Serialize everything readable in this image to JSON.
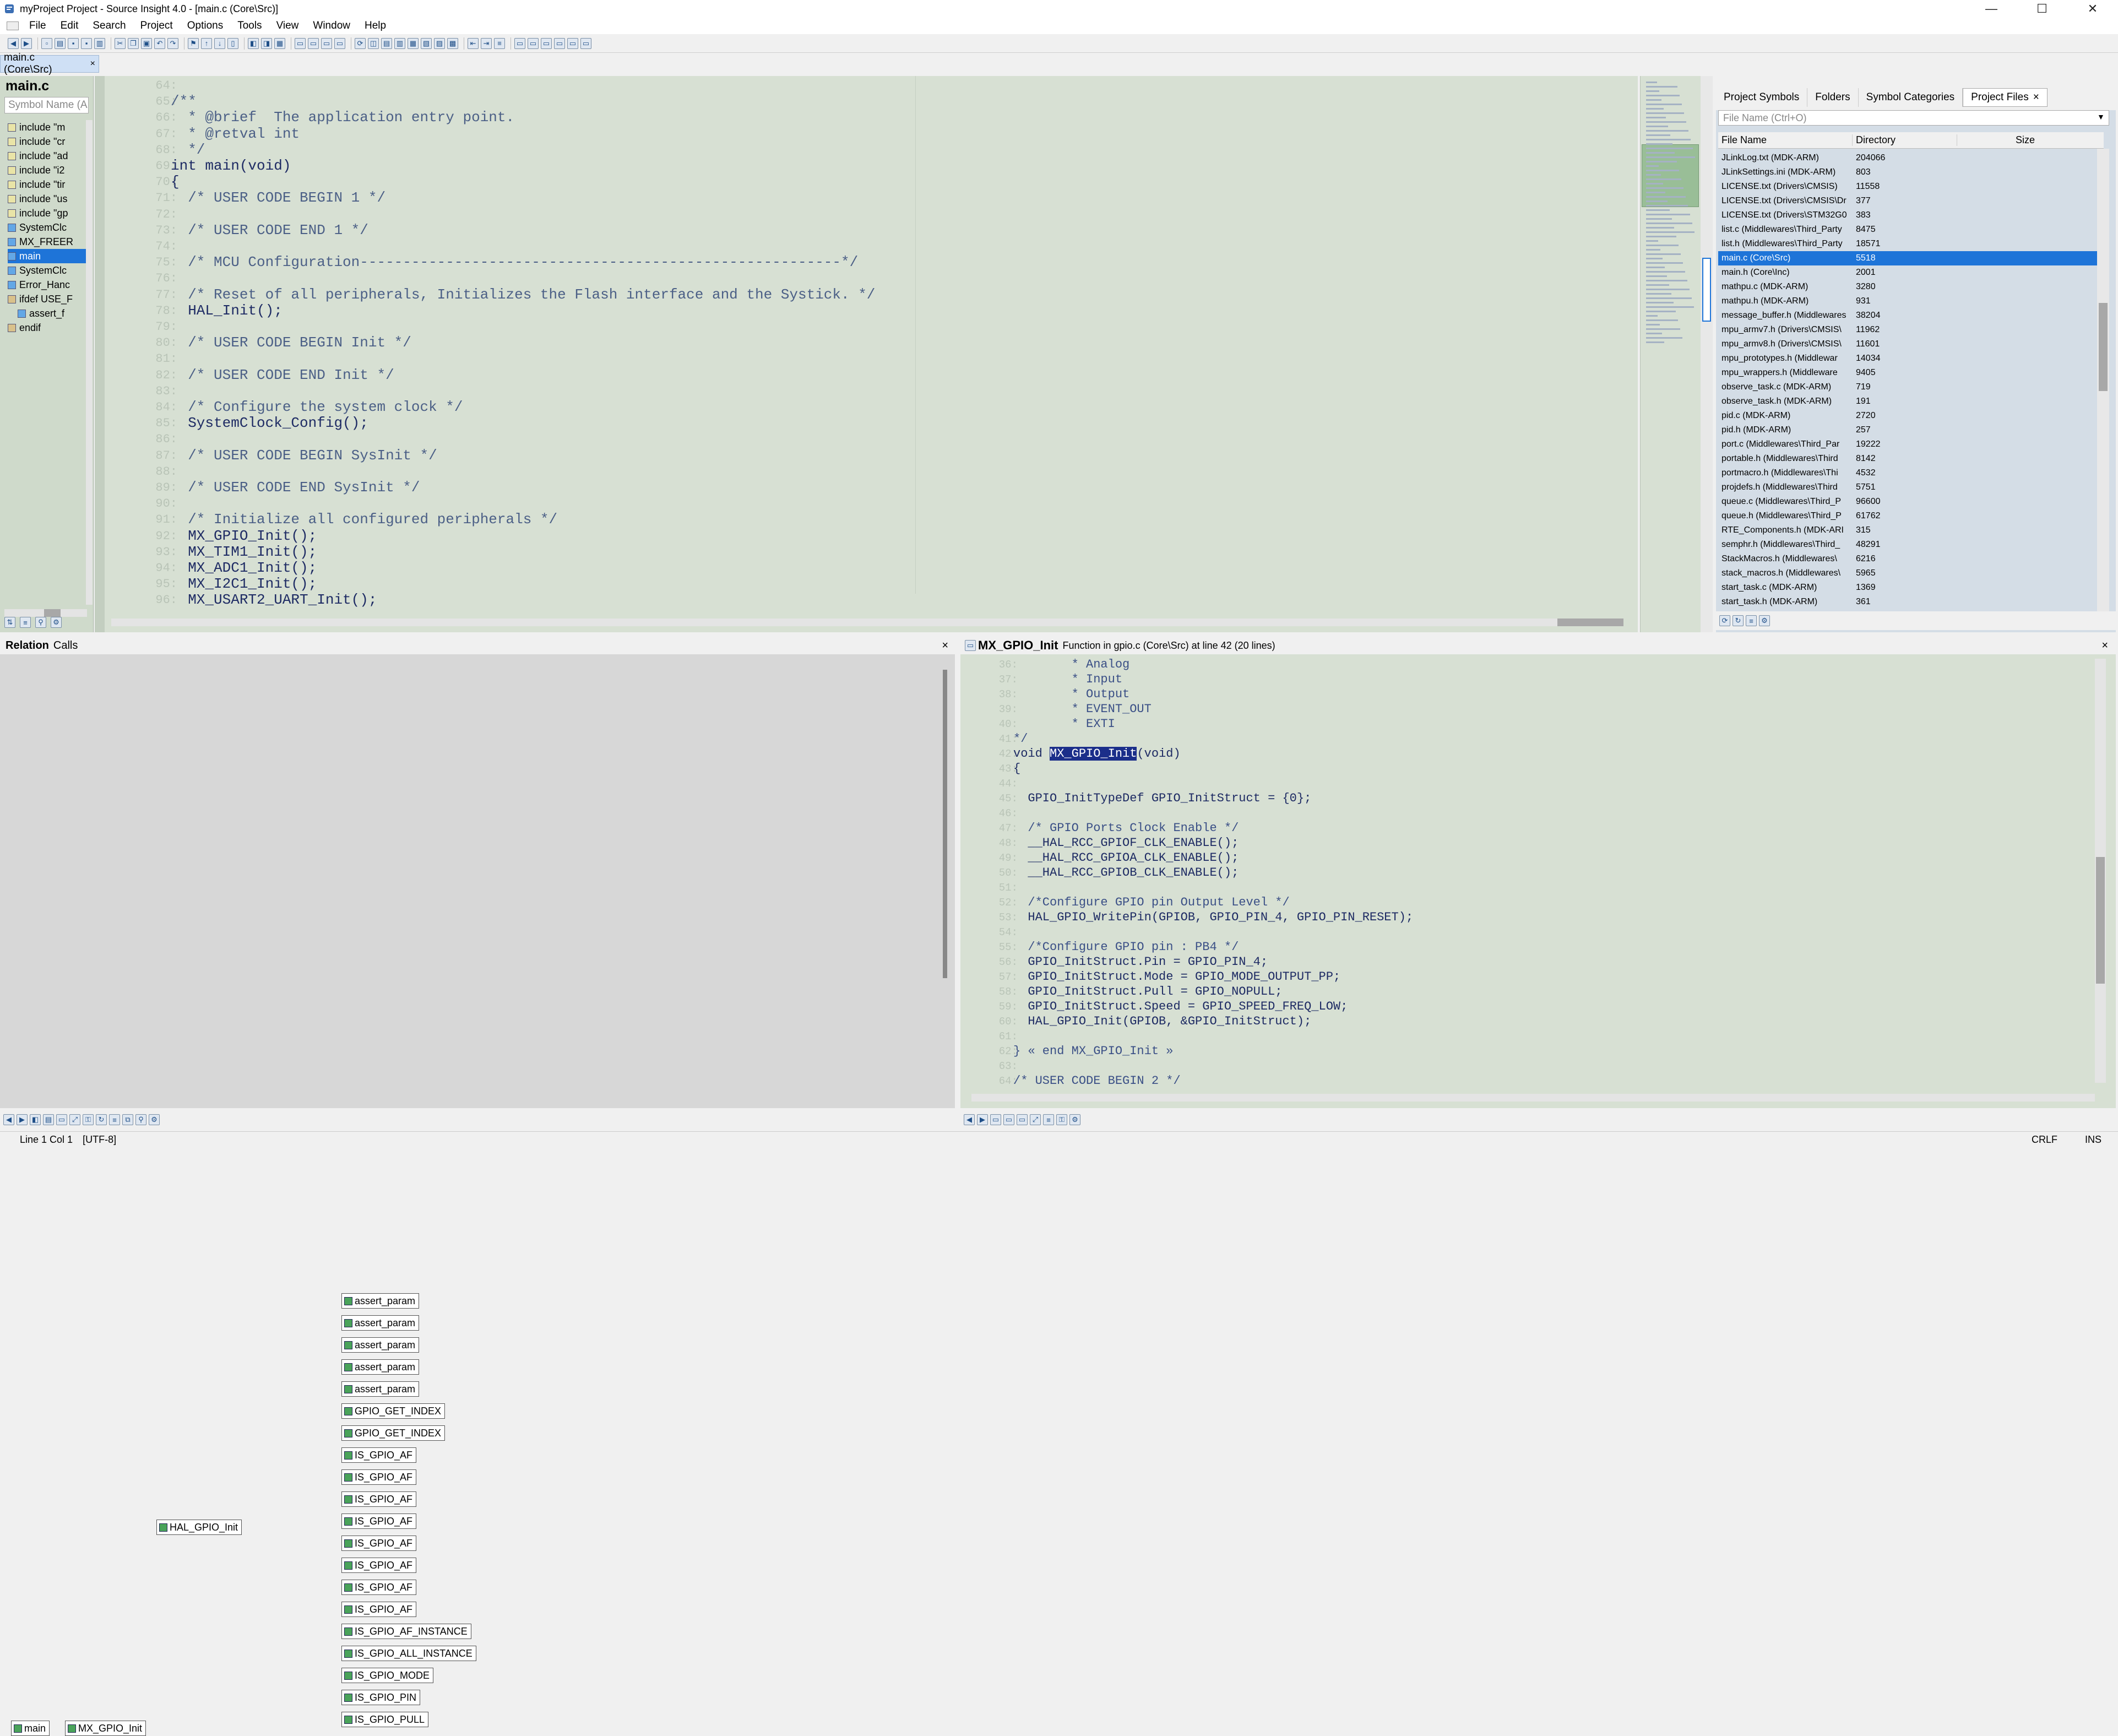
{
  "window": {
    "title": "myProject Project - Source Insight 4.0 - [main.c (Core\\Src)]",
    "minimize": "—",
    "maximize": "☐",
    "close": "✕"
  },
  "menu": [
    "File",
    "Edit",
    "Search",
    "Project",
    "Options",
    "Tools",
    "View",
    "Window",
    "Help"
  ],
  "doc_tab": {
    "label": "main.c (Core\\Src)",
    "close": "×"
  },
  "symbol_window": {
    "title": "main.c",
    "search_placeholder": "Symbol Name (A",
    "items": [
      {
        "label": "include \"m",
        "kind": "include"
      },
      {
        "label": "include \"cr",
        "kind": "include"
      },
      {
        "label": "include \"ad",
        "kind": "include"
      },
      {
        "label": "include \"i2",
        "kind": "include"
      },
      {
        "label": "include \"tir",
        "kind": "include"
      },
      {
        "label": "include \"us",
        "kind": "include"
      },
      {
        "label": "include \"gp",
        "kind": "include"
      },
      {
        "label": "SystemClc",
        "kind": "function"
      },
      {
        "label": "MX_FREER",
        "kind": "function"
      },
      {
        "label": "main",
        "kind": "function",
        "selected": true
      },
      {
        "label": "SystemClc",
        "kind": "function"
      },
      {
        "label": "Error_Hanc",
        "kind": "function"
      },
      {
        "label": "ifdef USE_F",
        "kind": "ifdef"
      },
      {
        "label": "assert_f",
        "kind": "function"
      },
      {
        "label": "endif",
        "kind": "ifdef"
      }
    ]
  },
  "code": {
    "line_numbers": [
      "64:",
      "65:",
      "66:",
      "67:",
      "68:",
      "69:",
      "70:",
      "71:",
      "72:",
      "73:",
      "74:",
      "75:",
      "76:",
      "77:",
      "78:",
      "79:",
      "80:",
      "81:",
      "82:",
      "83:",
      "84:",
      "85:",
      "86:",
      "87:",
      "88:",
      "89:",
      "90:",
      "91:",
      "92:",
      "93:",
      "94:",
      "95:",
      "96:"
    ],
    "lines": [
      "",
      "/**",
      "  * @brief  The application entry point.",
      "  * @retval int",
      "  */",
      "int main(void)",
      "{",
      "  /* USER CODE BEGIN 1 */",
      "",
      "  /* USER CODE END 1 */",
      "",
      "  /* MCU Configuration--------------------------------------------------------*/",
      "",
      "  /* Reset of all peripherals, Initializes the Flash interface and the Systick. */",
      "  HAL_Init();",
      "",
      "  /* USER CODE BEGIN Init */",
      "",
      "  /* USER CODE END Init */",
      "",
      "  /* Configure the system clock */",
      "  SystemClock_Config();",
      "",
      "  /* USER CODE BEGIN SysInit */",
      "",
      "  /* USER CODE END SysInit */",
      "",
      "  /* Initialize all configured peripherals */",
      "  MX_GPIO_Init();",
      "  MX_TIM1_Init();",
      "  MX_ADC1_Init();",
      "  MX_I2C1_Init();",
      "  MX_USART2_UART_Init();"
    ]
  },
  "project": {
    "tabs": [
      "Project Symbols",
      "Folders",
      "Symbol Categories",
      "Project Files"
    ],
    "active_tab_close": "×",
    "search_placeholder": "File Name (Ctrl+O)",
    "columns": [
      "File Name",
      "Directory",
      "Size"
    ],
    "files": [
      {
        "name": "JLinkLog.txt (MDK-ARM)",
        "size": "204066"
      },
      {
        "name": "JLinkSettings.ini (MDK-ARM)",
        "size": "803"
      },
      {
        "name": "LICENSE.txt (Drivers\\CMSIS)",
        "size": "11558"
      },
      {
        "name": "LICENSE.txt (Drivers\\CMSIS\\Dr",
        "size": "377"
      },
      {
        "name": "LICENSE.txt (Drivers\\STM32G0",
        "size": "383"
      },
      {
        "name": "list.c (Middlewares\\Third_Party",
        "size": "8475"
      },
      {
        "name": "list.h (Middlewares\\Third_Party",
        "size": "18571"
      },
      {
        "name": "main.c (Core\\Src)",
        "size": "5518",
        "selected": true
      },
      {
        "name": "main.h (Core\\Inc)",
        "size": "2001"
      },
      {
        "name": "mathpu.c (MDK-ARM)",
        "size": "3280"
      },
      {
        "name": "mathpu.h (MDK-ARM)",
        "size": "931"
      },
      {
        "name": "message_buffer.h (Middlewares",
        "size": "38204"
      },
      {
        "name": "mpu_armv7.h (Drivers\\CMSIS\\",
        "size": "11962"
      },
      {
        "name": "mpu_armv8.h (Drivers\\CMSIS\\",
        "size": "11601"
      },
      {
        "name": "mpu_prototypes.h (Middlewar",
        "size": "14034"
      },
      {
        "name": "mpu_wrappers.h (Middleware",
        "size": "9405"
      },
      {
        "name": "observe_task.c (MDK-ARM)",
        "size": "719"
      },
      {
        "name": "observe_task.h (MDK-ARM)",
        "size": "191"
      },
      {
        "name": "pid.c (MDK-ARM)",
        "size": "2720"
      },
      {
        "name": "pid.h (MDK-ARM)",
        "size": "257"
      },
      {
        "name": "port.c (Middlewares\\Third_Par",
        "size": "19222"
      },
      {
        "name": "portable.h (Middlewares\\Third",
        "size": "8142"
      },
      {
        "name": "portmacro.h (Middlewares\\Thi",
        "size": "4532"
      },
      {
        "name": "projdefs.h (Middlewares\\Third",
        "size": "5751"
      },
      {
        "name": "queue.c (Middlewares\\Third_P",
        "size": "96600"
      },
      {
        "name": "queue.h (Middlewares\\Third_P",
        "size": "61762"
      },
      {
        "name": "RTE_Components.h (MDK-ARI",
        "size": "315"
      },
      {
        "name": "semphr.h (Middlewares\\Third_",
        "size": "48291"
      },
      {
        "name": "StackMacros.h (Middlewares\\",
        "size": "6216"
      },
      {
        "name": "stack_macros.h (Middlewares\\",
        "size": "5965"
      },
      {
        "name": "start_task.c (MDK-ARM)",
        "size": "1369"
      },
      {
        "name": "start_task.h (MDK-ARM)",
        "size": "361"
      }
    ]
  },
  "relation": {
    "title": "Relation",
    "subtitle": "Calls",
    "close": "×",
    "root": "main",
    "caller": "MX_GPIO_Init",
    "middle": "HAL_GPIO_Init",
    "callees": [
      "assert_param",
      "assert_param",
      "assert_param",
      "assert_param",
      "assert_param",
      "GPIO_GET_INDEX",
      "GPIO_GET_INDEX",
      "IS_GPIO_AF",
      "IS_GPIO_AF",
      "IS_GPIO_AF",
      "IS_GPIO_AF",
      "IS_GPIO_AF",
      "IS_GPIO_AF",
      "IS_GPIO_AF",
      "IS_GPIO_AF",
      "IS_GPIO_AF_INSTANCE",
      "IS_GPIO_ALL_INSTANCE",
      "IS_GPIO_MODE",
      "IS_GPIO_PIN",
      "IS_GPIO_PULL"
    ]
  },
  "context": {
    "symbol": "MX_GPIO_Init",
    "info": "Function in gpio.c (Core\\Src) at line 42 (20 lines)",
    "close": "×",
    "line_numbers": [
      "36:",
      "37:",
      "38:",
      "39:",
      "40:",
      "41:",
      "42:",
      "43:",
      "44:",
      "45:",
      "46:",
      "47:",
      "48:",
      "49:",
      "50:",
      "51:",
      "52:",
      "53:",
      "54:",
      "55:",
      "56:",
      "57:",
      "58:",
      "59:",
      "60:",
      "61:",
      "62:",
      "63:",
      "64:"
    ],
    "lines": [
      "        * Analog",
      "        * Input",
      "        * Output",
      "        * EVENT_OUT",
      "        * EXTI",
      "*/",
      "",
      "{",
      "",
      "  GPIO_InitTypeDef GPIO_InitStruct = {0};",
      "",
      "  /* GPIO Ports Clock Enable */",
      "  __HAL_RCC_GPIOF_CLK_ENABLE();",
      "  __HAL_RCC_GPIOA_CLK_ENABLE();",
      "  __HAL_RCC_GPIOB_CLK_ENABLE();",
      "",
      "  /*Configure GPIO pin Output Level */",
      "  HAL_GPIO_WritePin(GPIOB, GPIO_PIN_4, GPIO_PIN_RESET);",
      "",
      "  /*Configure GPIO pin : PB4 */",
      "  GPIO_InitStruct.Pin = GPIO_PIN_4;",
      "  GPIO_InitStruct.Mode = GPIO_MODE_OUTPUT_PP;",
      "  GPIO_InitStruct.Pull = GPIO_NOPULL;",
      "  GPIO_InitStruct.Speed = GPIO_SPEED_FREQ_LOW;",
      "  HAL_GPIO_Init(GPIOB, &GPIO_InitStruct);",
      "",
      "} « end MX_GPIO_Init »",
      "",
      "/* USER CODE BEGIN 2 */"
    ],
    "decl_prefix": "void ",
    "decl_name": "MX_GPIO_Init",
    "decl_suffix": "(void)"
  },
  "status": {
    "position": "Line 1  Col 1",
    "encoding": "[UTF-8]",
    "eol": "CRLF",
    "mode": "INS"
  }
}
